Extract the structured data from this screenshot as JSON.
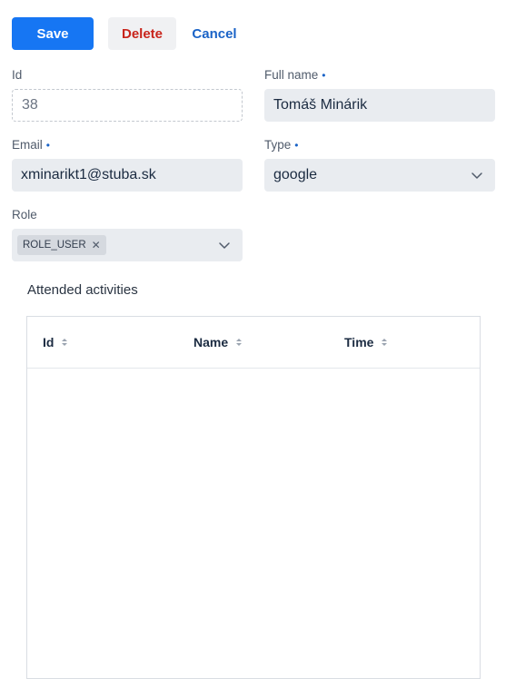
{
  "toolbar": {
    "save_label": "Save",
    "delete_label": "Delete",
    "cancel_label": "Cancel"
  },
  "form": {
    "id": {
      "label": "Id",
      "value": "38"
    },
    "full_name": {
      "label": "Full name",
      "required_marker": "•",
      "value": "Tomáš Minárik"
    },
    "email": {
      "label": "Email",
      "required_marker": "•",
      "value": "xminarikt1@stuba.sk"
    },
    "type": {
      "label": "Type",
      "required_marker": "•",
      "value": "google"
    },
    "role": {
      "label": "Role",
      "chips": [
        "ROLE_USER"
      ],
      "chip_remove": "✕"
    }
  },
  "activities": {
    "title": "Attended activities",
    "columns": [
      "Id",
      "Name",
      "Time"
    ],
    "rows": []
  },
  "colors": {
    "primary": "#1676f3",
    "error": "#c8241b",
    "link": "#1a63c7"
  }
}
